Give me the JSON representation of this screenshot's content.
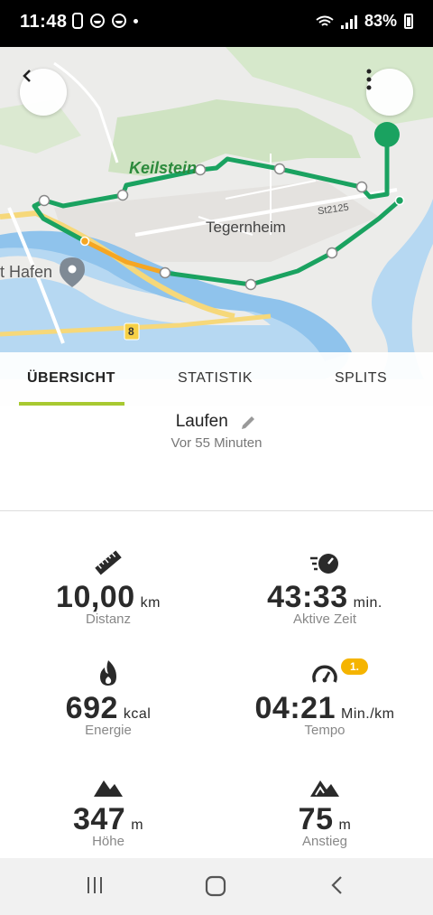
{
  "status_bar": {
    "time": "11:48",
    "battery": "83%"
  },
  "map": {
    "labels": {
      "keilstein": "Keilstein",
      "tegernheim": "Tegernheim",
      "hafen": "t Hafen",
      "st2125": "St2125",
      "road8": "8"
    }
  },
  "tabs": [
    {
      "label": "ÜBERSICHT",
      "active": true
    },
    {
      "label": "STATISTIK",
      "active": false
    },
    {
      "label": "SPLITS",
      "active": false
    }
  ],
  "activity": {
    "name": "Laufen",
    "time_ago": "Vor 55 Minuten"
  },
  "stats": [
    {
      "value": "10,00",
      "unit": "km",
      "label": "Distanz",
      "icon": "ruler-icon"
    },
    {
      "value": "43:33",
      "unit": "min.",
      "label": "Aktive Zeit",
      "icon": "stopwatch-icon"
    },
    {
      "value": "692",
      "unit": "kcal",
      "label": "Energie",
      "icon": "flame-icon"
    },
    {
      "value": "04:21",
      "unit": "Min./km",
      "label": "Tempo",
      "icon": "speedometer-icon",
      "badge": "1."
    },
    {
      "value": "347",
      "unit": "m",
      "label": "Höhe",
      "icon": "mountain-icon"
    },
    {
      "value": "75",
      "unit": "m",
      "label": "Anstieg",
      "icon": "mountain-ascent-icon"
    }
  ],
  "colors": {
    "route": "#1aa260",
    "route_fast": "#f5a623",
    "tab_accent": "#a8c931",
    "badge": "#f5b400"
  }
}
